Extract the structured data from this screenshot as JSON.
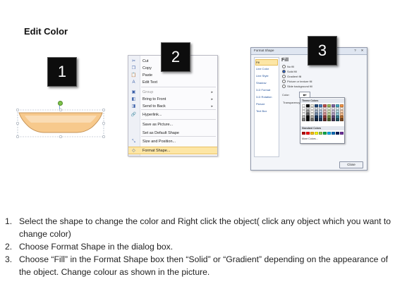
{
  "title": "Edit Color",
  "badges": [
    "1",
    "2",
    "3"
  ],
  "shape": {
    "fill": "#f7c98c",
    "stroke": "#c79558",
    "handle": "#7ec34a"
  },
  "context_menu": {
    "items": [
      {
        "label": "Cut",
        "icon": "scissors-icon",
        "glyph": "✂"
      },
      {
        "label": "Copy",
        "icon": "copy-icon",
        "glyph": "❐"
      },
      {
        "label": "Paste",
        "icon": "paste-icon",
        "glyph": "📋"
      },
      {
        "label": "Edit Text",
        "icon": "edit-text-icon",
        "glyph": "A"
      },
      {
        "label": "Group",
        "icon": "group-icon",
        "glyph": "▣",
        "disabled": true,
        "submenu": true
      },
      {
        "label": "Bring to Front",
        "icon": "bring-to-front-icon",
        "glyph": "◧",
        "submenu": true
      },
      {
        "label": "Send to Back",
        "icon": "send-to-back-icon",
        "glyph": "◨",
        "submenu": true
      },
      {
        "label": "Hyperlink...",
        "icon": "hyperlink-icon",
        "glyph": "🔗"
      },
      {
        "label": "Save as Picture...",
        "icon": "",
        "glyph": ""
      },
      {
        "label": "Set as Default Shape",
        "icon": "",
        "glyph": ""
      },
      {
        "label": "Size and Position...",
        "icon": "size-position-icon",
        "glyph": "⤡"
      },
      {
        "label": "Format Shape...",
        "icon": "format-shape-icon",
        "glyph": "◇",
        "highlight": true
      }
    ]
  },
  "dialog": {
    "title": "Format Shape",
    "controls": [
      "?",
      "✕"
    ],
    "nav": [
      "Fill",
      "Line Color",
      "Line Style",
      "Shadow",
      "3-D Format",
      "3-D Rotation",
      "Picture",
      "Text Box"
    ],
    "fill_heading": "Fill",
    "options": [
      "No fill",
      "Solid fill",
      "Gradient fill",
      "Picture or texture fill",
      "Slide background fill"
    ],
    "selected_option": "Solid fill",
    "color_label": "Color:",
    "transparency_label": "Transparency:",
    "close_label": "Close"
  },
  "palette": {
    "theme_heading": "Theme Colors",
    "standard_heading": "Standard Colors",
    "more_label": "More Colors...",
    "theme_row": [
      "#ffffff",
      "#000000",
      "#eeece1",
      "#1f497d",
      "#4f81bd",
      "#c0504d",
      "#9bbb59",
      "#8064a2",
      "#4bacc6",
      "#f79646"
    ],
    "standard_row": [
      "#c00000",
      "#ff0000",
      "#ffc000",
      "#ffff00",
      "#92d050",
      "#00b050",
      "#00b0f0",
      "#0070c0",
      "#002060",
      "#7030a0"
    ]
  },
  "instructions": [
    {
      "num": "1.",
      "text": "Select the shape to change the color and Right click the object( click any object which you want to change color)"
    },
    {
      "num": "2.",
      "text": "Choose Format Shape in the dialog box."
    },
    {
      "num": "3.",
      "text": "Choose “Fill” in the Format Shape box then “Solid” or “Gradient” depending on the appearance of the object. Change colour as shown in the picture."
    }
  ]
}
